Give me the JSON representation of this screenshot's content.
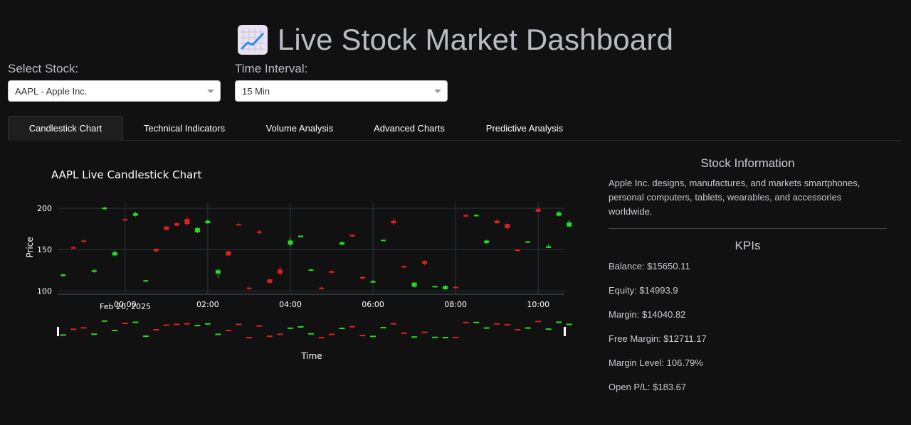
{
  "header": {
    "title": "Live Stock Market Dashboard",
    "icon": "chart-increasing-icon"
  },
  "controls": {
    "stock_label": "Select Stock:",
    "stock_value": "AAPL - Apple Inc.",
    "interval_label": "Time Interval:",
    "interval_value": "15 Min"
  },
  "tabs": [
    {
      "label": "Candlestick Chart",
      "active": true
    },
    {
      "label": "Technical Indicators",
      "active": false
    },
    {
      "label": "Volume Analysis",
      "active": false
    },
    {
      "label": "Advanced Charts",
      "active": false
    },
    {
      "label": "Predictive Analysis",
      "active": false
    }
  ],
  "colors": {
    "up": "#22dd22",
    "down": "#dd2222",
    "background": "#111111",
    "grid": "#2a3440"
  },
  "chart_data": {
    "type": "candlestick",
    "title": "AAPL Live Candlestick Chart",
    "xlabel": "Time",
    "ylabel": "Price",
    "ylim": [
      96,
      207
    ],
    "y_ticks": [
      100,
      150,
      200
    ],
    "x_ticks": [
      "00:00",
      "02:00",
      "04:00",
      "06:00",
      "08:00",
      "10:00"
    ],
    "x_subtick": "Feb 20, 2025",
    "x_range_minutes": [
      -98,
      638
    ],
    "rangeslider": true,
    "candles": [
      {
        "t": "22:30",
        "open": 118,
        "high": 121,
        "low": 117,
        "close": 120
      },
      {
        "t": "22:45",
        "open": 153,
        "high": 154,
        "low": 151,
        "close": 152
      },
      {
        "t": "23:00",
        "open": 161,
        "high": 162,
        "low": 159,
        "close": 160
      },
      {
        "t": "23:15",
        "open": 123,
        "high": 127,
        "low": 122,
        "close": 125
      },
      {
        "t": "23:30",
        "open": 199,
        "high": 202,
        "low": 198,
        "close": 201
      },
      {
        "t": "23:45",
        "open": 143,
        "high": 149,
        "low": 142,
        "close": 147
      },
      {
        "t": "00:00",
        "open": 187,
        "high": 188,
        "low": 185,
        "close": 186
      },
      {
        "t": "00:15",
        "open": 191,
        "high": 196,
        "low": 190,
        "close": 194
      },
      {
        "t": "00:30",
        "open": 112,
        "high": 113,
        "low": 111,
        "close": 113
      },
      {
        "t": "00:45",
        "open": 151,
        "high": 152,
        "low": 147,
        "close": 148
      },
      {
        "t": "01:00",
        "open": 178,
        "high": 179,
        "low": 173,
        "close": 174
      },
      {
        "t": "01:15",
        "open": 182,
        "high": 183,
        "low": 178,
        "close": 179
      },
      {
        "t": "01:30",
        "open": 187,
        "high": 190,
        "low": 179,
        "close": 181
      },
      {
        "t": "01:45",
        "open": 171,
        "high": 177,
        "low": 170,
        "close": 176
      },
      {
        "t": "02:00",
        "open": 182,
        "high": 186,
        "low": 181,
        "close": 185
      },
      {
        "t": "02:15",
        "open": 121,
        "high": 127,
        "low": 116,
        "close": 125
      },
      {
        "t": "02:30",
        "open": 148,
        "high": 149,
        "low": 142,
        "close": 143
      },
      {
        "t": "02:45",
        "open": 181,
        "high": 182,
        "low": 179,
        "close": 180
      },
      {
        "t": "03:00",
        "open": 104,
        "high": 105,
        "low": 102,
        "close": 103
      },
      {
        "t": "03:15",
        "open": 172,
        "high": 174,
        "low": 168,
        "close": 171
      },
      {
        "t": "03:30",
        "open": 114,
        "high": 115,
        "low": 109,
        "close": 110
      },
      {
        "t": "03:45",
        "open": 126,
        "high": 130,
        "low": 118,
        "close": 121
      },
      {
        "t": "04:00",
        "open": 156,
        "high": 165,
        "low": 154,
        "close": 161
      },
      {
        "t": "04:15",
        "open": 165,
        "high": 167,
        "low": 165,
        "close": 167
      },
      {
        "t": "04:30",
        "open": 126,
        "high": 127,
        "low": 125,
        "close": 126
      },
      {
        "t": "04:45",
        "open": 104,
        "high": 105,
        "low": 102,
        "close": 103
      },
      {
        "t": "05:00",
        "open": 124,
        "high": 125,
        "low": 121,
        "close": 122
      },
      {
        "t": "05:15",
        "open": 156,
        "high": 160,
        "low": 156,
        "close": 159
      },
      {
        "t": "05:30",
        "open": 168,
        "high": 168,
        "low": 165,
        "close": 166
      },
      {
        "t": "05:45",
        "open": 117,
        "high": 117,
        "low": 114,
        "close": 115
      },
      {
        "t": "06:00",
        "open": 110,
        "high": 113,
        "low": 110,
        "close": 112
      },
      {
        "t": "06:15",
        "open": 161,
        "high": 162,
        "low": 161,
        "close": 162
      },
      {
        "t": "06:30",
        "open": 185,
        "high": 188,
        "low": 180,
        "close": 182
      },
      {
        "t": "06:45",
        "open": 130,
        "high": 131,
        "low": 128,
        "close": 129
      },
      {
        "t": "07:00",
        "open": 105,
        "high": 111,
        "low": 104,
        "close": 110
      },
      {
        "t": "07:15",
        "open": 136,
        "high": 137,
        "low": 131,
        "close": 133
      },
      {
        "t": "07:30",
        "open": 105,
        "high": 106,
        "low": 105,
        "close": 106
      },
      {
        "t": "07:45",
        "open": 102,
        "high": 107,
        "low": 101,
        "close": 106
      },
      {
        "t": "08:00",
        "open": 105,
        "high": 106,
        "low": 103,
        "close": 104
      },
      {
        "t": "08:15",
        "open": 192,
        "high": 193,
        "low": 189,
        "close": 190
      },
      {
        "t": "08:30",
        "open": 191,
        "high": 193,
        "low": 191,
        "close": 192
      },
      {
        "t": "08:45",
        "open": 158,
        "high": 162,
        "low": 157,
        "close": 161
      },
      {
        "t": "09:00",
        "open": 185,
        "high": 187,
        "low": 181,
        "close": 182
      },
      {
        "t": "09:15",
        "open": 181,
        "high": 182,
        "low": 174,
        "close": 176
      },
      {
        "t": "09:30",
        "open": 150,
        "high": 151,
        "low": 148,
        "close": 149
      },
      {
        "t": "09:45",
        "open": 159,
        "high": 160,
        "low": 158,
        "close": 160
      },
      {
        "t": "10:00",
        "open": 199,
        "high": 201,
        "low": 195,
        "close": 196
      },
      {
        "t": "10:15",
        "open": 152,
        "high": 157,
        "low": 152,
        "close": 154
      },
      {
        "t": "10:30",
        "open": 191,
        "high": 197,
        "low": 190,
        "close": 195
      },
      {
        "t": "10:45",
        "open": 178,
        "high": 186,
        "low": 177,
        "close": 183
      }
    ]
  },
  "info": {
    "title": "Stock Information",
    "description": "Apple Inc. designs, manufactures, and markets smartphones, personal computers, tablets, wearables, and accessories worldwide.",
    "kpi_title": "KPIs",
    "kpis": [
      "Balance: $15650.11",
      "Equity: $14993.9",
      "Margin: $14040.82",
      "Free Margin: $12711.17",
      "Margin Level: 106.79%",
      "Open P/L: $183.67"
    ]
  }
}
